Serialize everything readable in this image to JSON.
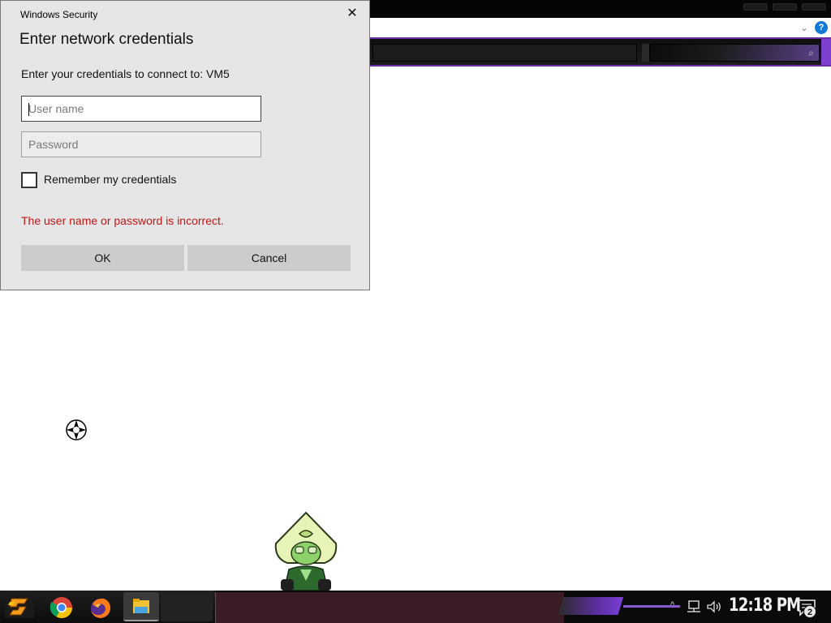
{
  "dialog": {
    "caption": "Windows Security",
    "close_glyph": "✕",
    "heading": "Enter network credentials",
    "instruction": "Enter your credentials to connect to: VM5",
    "username": {
      "value": "",
      "placeholder": "User name"
    },
    "password": {
      "value": "",
      "placeholder": "Password"
    },
    "remember_label": "Remember my credentials",
    "remember_checked": false,
    "error": "The user name or password is incorrect.",
    "ok_label": "OK",
    "cancel_label": "Cancel",
    "error_color": "#c01818"
  },
  "background_window": {
    "ribbon_chevron_glyph": "⌄",
    "help_glyph": "?",
    "search_glyph": "⌕",
    "accent_color": "#7d3fd0"
  },
  "taskbar": {
    "pinned": [
      {
        "name": "start",
        "icon": "start-logo-icon"
      },
      {
        "name": "Google Chrome",
        "icon": "chrome-icon"
      },
      {
        "name": "Firefox",
        "icon": "firefox-icon"
      },
      {
        "name": "File Explorer",
        "icon": "folder-icon"
      }
    ],
    "tray": {
      "chevron_glyph": "^",
      "network_icon": "network-icon",
      "volume_icon": "speaker-icon",
      "clock": "12:18 PM",
      "notification_count": "2"
    }
  },
  "desktop": {
    "cursor": "busy-cursor-icon",
    "mascot": "character-sticker"
  }
}
